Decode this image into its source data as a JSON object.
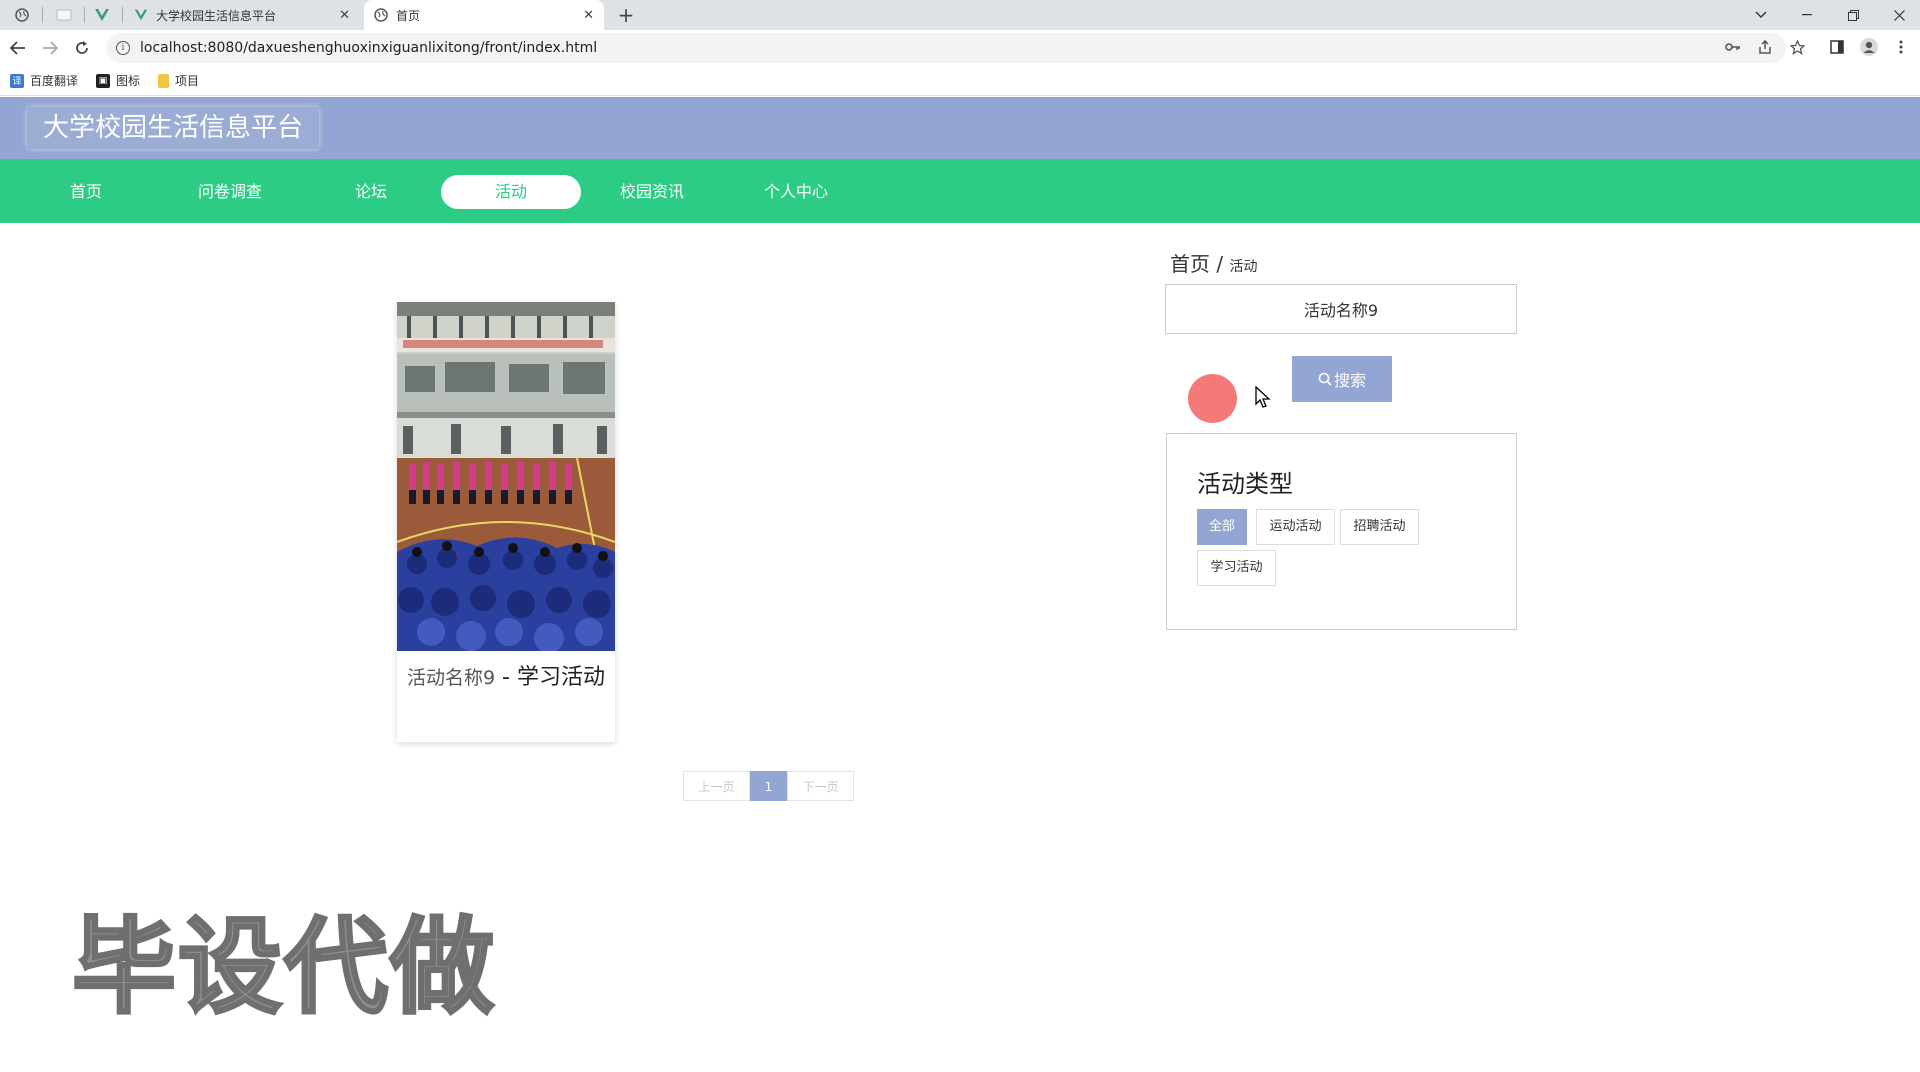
{
  "browser": {
    "tabs": [
      {
        "title": "大学校园生活信息平台",
        "active": false
      },
      {
        "title": "首页",
        "active": true
      }
    ],
    "address": "localhost:8080/daxueshenghuoxinxiguanlixitong/front/index.html",
    "bookmarks": [
      {
        "label": "百度翻译",
        "icon": "translate-icon",
        "color": "#3c78d8"
      },
      {
        "label": "图标",
        "icon": "image-icon",
        "color": "#222222"
      },
      {
        "label": "项目",
        "icon": "folder-icon",
        "color": "#f4c542"
      }
    ]
  },
  "site": {
    "title": "大学校园生活信息平台",
    "header_color": "#93a5d2",
    "nav_color": "#2ccc85",
    "nav": [
      {
        "label": "首页",
        "active": false
      },
      {
        "label": "问卷调查",
        "active": false
      },
      {
        "label": "论坛",
        "active": false
      },
      {
        "label": "活动",
        "active": true
      },
      {
        "label": "校园资讯",
        "active": false
      },
      {
        "label": "个人中心",
        "active": false
      }
    ]
  },
  "breadcrumb": {
    "home": "首页",
    "separator": "/",
    "current": "活动"
  },
  "search": {
    "value": "活动名称9",
    "button_label": "搜索"
  },
  "filter": {
    "title": "活动类型",
    "chips": [
      {
        "label": "全部",
        "active": true
      },
      {
        "label": "运动活动",
        "active": false
      },
      {
        "label": "招聘活动",
        "active": false
      },
      {
        "label": "学习活动",
        "active": false
      }
    ]
  },
  "activities": [
    {
      "name": "活动名称9",
      "separator": " - ",
      "type": "学习活动"
    }
  ],
  "pager": {
    "prev": "上一页",
    "current": "1",
    "next": "下一页"
  },
  "watermark": "毕设代做"
}
